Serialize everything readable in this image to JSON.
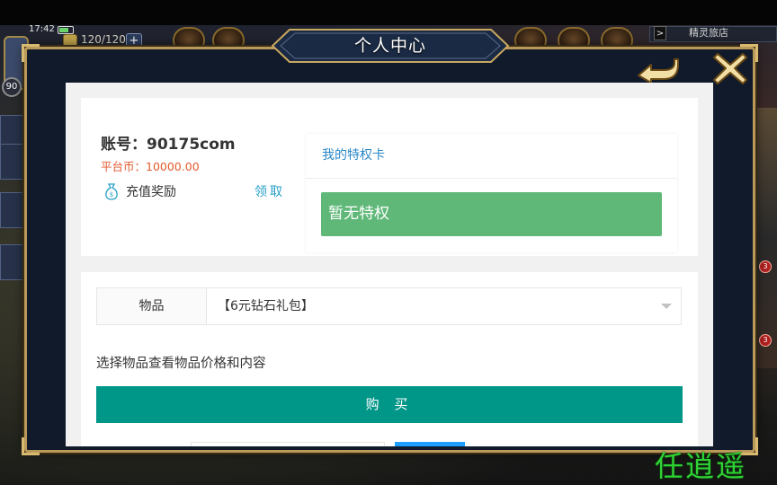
{
  "status_bar": {
    "time": "17:42",
    "battery_level": 0.7
  },
  "game_hud": {
    "energy": "120/120",
    "energy_plus": "+",
    "level": "90",
    "spirit_shop_label": "精灵旅店",
    "spirit_arrow": ">",
    "badge_count": "3"
  },
  "dialog": {
    "title": "个人中心",
    "back_icon": "back-arrow-icon",
    "close_icon": "close-x-icon"
  },
  "account_card": {
    "account_label": "账号：",
    "account_value": "90175com",
    "platform_coins": "平台币：10000.00",
    "reward_label": "充值奖励",
    "claim_label": "领取"
  },
  "privilege_card": {
    "title": "我的特权卡",
    "empty_text": "暂无特权"
  },
  "purchase": {
    "item_label": "物品",
    "selected_item": "【6元钻石礼包】",
    "hint": "选择物品查看物品价格和内容",
    "buy_label": "购 买"
  },
  "colors": {
    "accent_teal": "#009688",
    "success_green": "#5fb878",
    "link_blue": "#2b88c9",
    "coin_orange": "#e2592b",
    "frame_gold": "#b99a5a"
  },
  "watermark": "任逍遥"
}
